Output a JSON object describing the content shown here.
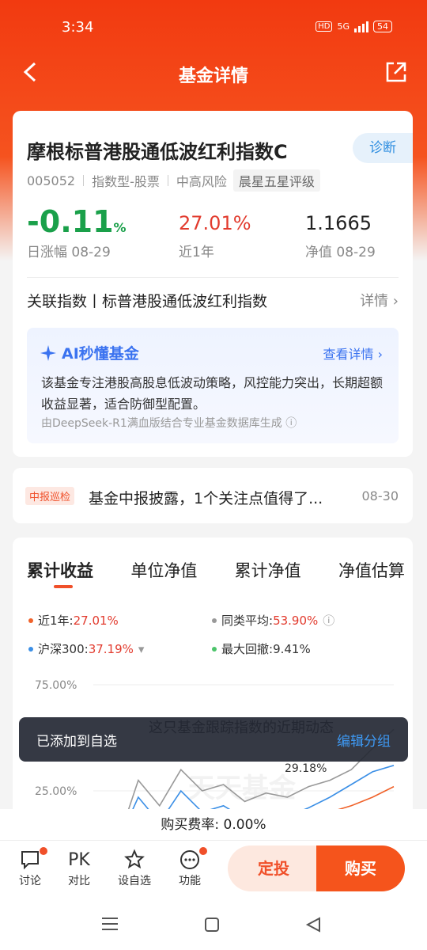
{
  "status": {
    "time": "3:34",
    "hd": "HD",
    "net": "5G",
    "battery": "54"
  },
  "nav": {
    "title": "基金详情"
  },
  "fund": {
    "name": "摩根标普港股通低波红利指数C",
    "diagnose": "诊断",
    "code": "005052",
    "type": "指数型-股票",
    "risk": "中高风险",
    "rating": "晨星五星评级",
    "day_change": "-0.11",
    "day_change_unit": "%",
    "day_label": "日涨幅 08-29",
    "year_return": "27.01%",
    "year_label": "近1年",
    "nav_value": "1.1665",
    "nav_label": "净值 08-29"
  },
  "related": {
    "label": "关联指数丨标普港股通低波红利指数",
    "detail": "详情"
  },
  "ai": {
    "title": "AI秒懂基金",
    "more": "查看详情",
    "text": "该基金专注港股高股息低波动策略，风控能力突出，长期超额收益显著，适合防御型配置。",
    "source": "由DeepSeek-R1满血版结合专业基金数据库生成"
  },
  "news": {
    "badge": "中报巡检",
    "title": "基金中报披露，1个关注点值得了...",
    "date": "08-30"
  },
  "tabs": [
    "累计收益",
    "单位净值",
    "累计净值",
    "净值估算"
  ],
  "legend": {
    "fund_label": "近1年:",
    "fund_value": "27.01%",
    "peer_label": "同类平均:",
    "peer_value": "53.90%",
    "hs300_label": "沪深300:",
    "hs300_value": "37.19%",
    "drawdown_label": "最大回撤:",
    "drawdown_value": "9.41%"
  },
  "chart_data": {
    "type": "line",
    "ytick_labels": [
      "75.00%",
      "25.00%"
    ],
    "annotation": "29.18%",
    "watermark": "天天基金",
    "overlay_text": "这只基金跟踪指数的近期动态",
    "colors": {
      "fund": "#f0622a",
      "peer": "#999999",
      "hs300": "#3b8fe6"
    },
    "series": [
      {
        "name": "近1年",
        "values": [
          0,
          4,
          2,
          6,
          3,
          5,
          8,
          7,
          10,
          12,
          15,
          18,
          22,
          27
        ]
      },
      {
        "name": "同类平均",
        "values": [
          0,
          30,
          18,
          35,
          25,
          28,
          20,
          24,
          22,
          27,
          30,
          35,
          45,
          54
        ]
      },
      {
        "name": "沪深300",
        "values": [
          0,
          22,
          10,
          25,
          15,
          18,
          12,
          14,
          13,
          17,
          22,
          28,
          34,
          37
        ]
      }
    ]
  },
  "toast": {
    "message": "已添加到自选",
    "action": "编辑分组"
  },
  "fee": "购买费率: 0.00%",
  "bottom": {
    "discuss": "讨论",
    "pk": "PK",
    "compare": "对比",
    "watch": "设自选",
    "function": "功能",
    "fixed": "定投",
    "buy": "购买"
  }
}
